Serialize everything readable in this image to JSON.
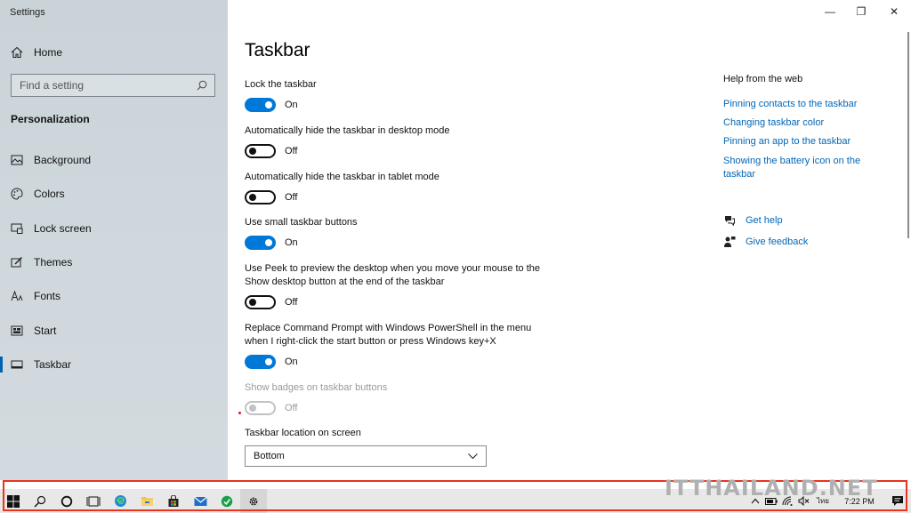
{
  "window": {
    "app_title": "Settings",
    "controls": {
      "minimize": "—",
      "restore": "❐",
      "close": "✕"
    }
  },
  "sidebar": {
    "home_label": "Home",
    "search_placeholder": "Find a setting",
    "section_title": "Personalization",
    "items": [
      {
        "label": "Background",
        "icon": "image-icon"
      },
      {
        "label": "Colors",
        "icon": "palette-icon"
      },
      {
        "label": "Lock screen",
        "icon": "lock-screen-icon"
      },
      {
        "label": "Themes",
        "icon": "themes-icon"
      },
      {
        "label": "Fonts",
        "icon": "fonts-icon"
      },
      {
        "label": "Start",
        "icon": "start-icon"
      },
      {
        "label": "Taskbar",
        "icon": "taskbar-icon",
        "active": true
      }
    ]
  },
  "main": {
    "title": "Taskbar",
    "settings": [
      {
        "label": "Lock the taskbar",
        "state": "On"
      },
      {
        "label": "Automatically hide the taskbar in desktop mode",
        "state": "Off"
      },
      {
        "label": "Automatically hide the taskbar in tablet mode",
        "state": "Off"
      },
      {
        "label": "Use small taskbar buttons",
        "state": "On"
      },
      {
        "label": "Use Peek to preview the desktop when you move your mouse to the Show desktop button at the end of the taskbar",
        "state": "Off"
      },
      {
        "label": "Replace Command Prompt with Windows PowerShell in the menu when I right-click the start button or press Windows key+X",
        "state": "On"
      },
      {
        "label": "Show badges on taskbar buttons",
        "state": "Off",
        "disabled": true
      }
    ],
    "location_label": "Taskbar location on screen",
    "location_value": "Bottom"
  },
  "help": {
    "title": "Help from the web",
    "links": [
      "Pinning contacts to the taskbar",
      "Changing taskbar color",
      "Pinning an app to the taskbar",
      "Showing the battery icon on the taskbar"
    ],
    "get_help": "Get help",
    "give_feedback": "Give feedback"
  },
  "taskbar": {
    "language": "ไทย",
    "time": "7:22 PM"
  },
  "watermark": "ITTHAILAND.NET",
  "colors": {
    "accent": "#0078d7",
    "link": "#0067b8",
    "highlight_frame": "#e8341c"
  }
}
